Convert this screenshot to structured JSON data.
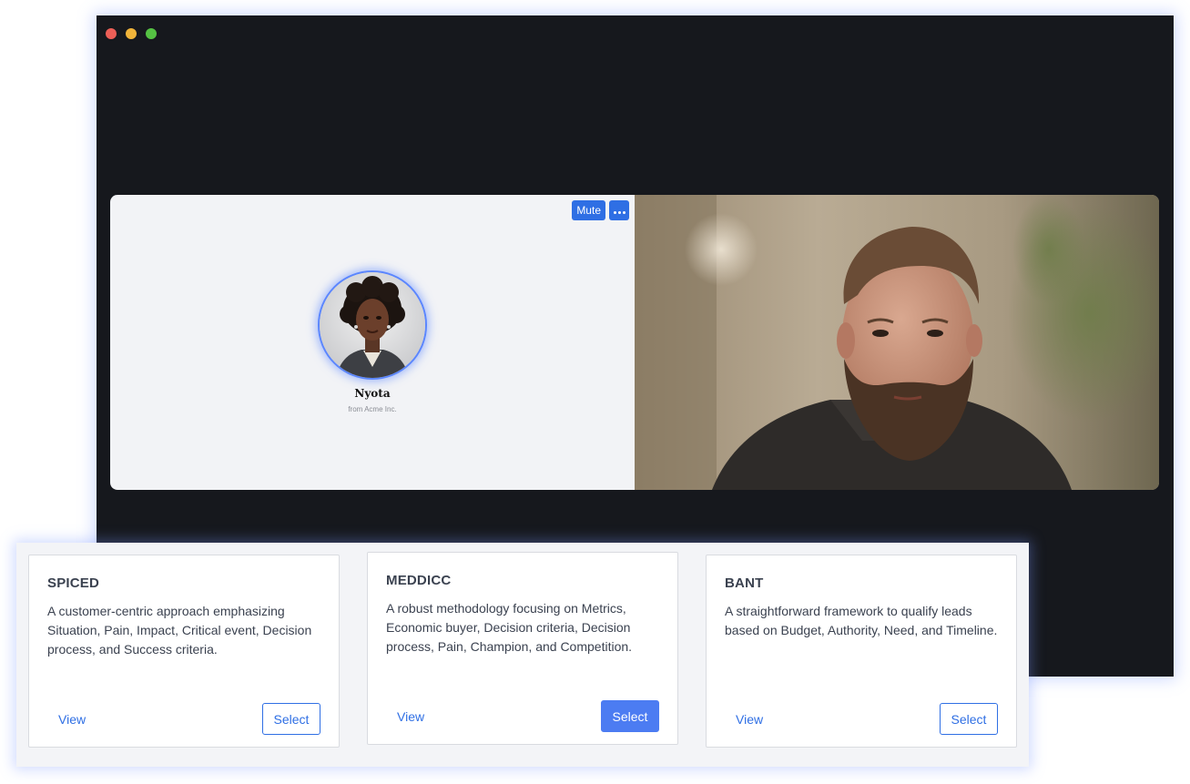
{
  "window": {
    "traffic_lights": [
      "#ec5f57",
      "#f0b43a",
      "#55c243"
    ]
  },
  "call": {
    "controls": {
      "mute_label": "Mute",
      "more_icon": "more-horizontal-icon"
    },
    "agent": {
      "name": "Nyota",
      "company": "from Acme Inc."
    }
  },
  "frameworks": [
    {
      "title": "SPICED",
      "description": "A customer-centric approach emphasizing Situation, Pain, Impact, Critical event, Decision process, and Success criteria.",
      "view_label": "View",
      "select_label": "Select",
      "selected": false
    },
    {
      "title": "MEDDICC",
      "description": "A robust methodology focusing on Metrics, Economic buyer, Decision criteria, Decision process, Pain, Champion, and Competition.",
      "view_label": "View",
      "select_label": "Select",
      "selected": true
    },
    {
      "title": "BANT",
      "description": "A straightforward framework to qualify leads based on Budget, Authority, Need, and Timeline.",
      "view_label": "View",
      "select_label": "Select",
      "selected": false
    }
  ],
  "colors": {
    "accent": "#2f6fe4",
    "selected_button": "#4c7cf2",
    "window_bg": "#16181d"
  }
}
